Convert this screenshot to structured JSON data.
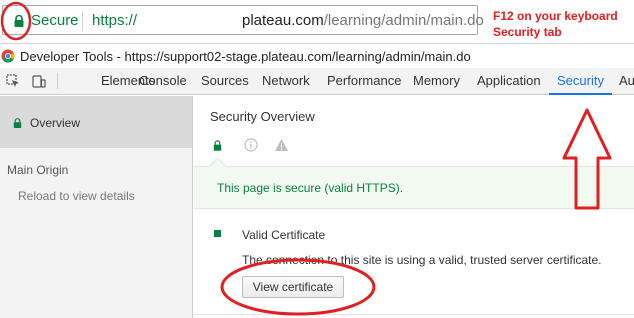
{
  "address_bar": {
    "secure_label": "Secure",
    "protocol": "https://",
    "host": "plateau.com",
    "path": "/learning/admin/main.do"
  },
  "annotation": {
    "line1": "F12 on your keyboard",
    "line2": "Security tab",
    "color": "#e02020"
  },
  "devtools": {
    "window_title": "Developer Tools - https://support02-stage.plateau.com/learning/admin/main.do",
    "tabs": [
      {
        "label": "Elements"
      },
      {
        "label": "Console"
      },
      {
        "label": "Sources"
      },
      {
        "label": "Network"
      },
      {
        "label": "Performance"
      },
      {
        "label": "Memory"
      },
      {
        "label": "Application"
      },
      {
        "label": "Security",
        "active": true
      },
      {
        "label": "Au"
      }
    ],
    "accent_color": "#1a73e8"
  },
  "sidebar": {
    "overview_label": "Overview",
    "main_origin_label": "Main Origin",
    "reload_hint": "Reload to view details"
  },
  "main": {
    "title": "Security Overview",
    "secure_message": "This page is secure (valid HTTPS).",
    "certificate": {
      "title": "Valid Certificate",
      "description": "The connection to this site is using a valid, trusted server certificate.",
      "button_label": "View certificate"
    },
    "secure_color": "#0b8043"
  }
}
